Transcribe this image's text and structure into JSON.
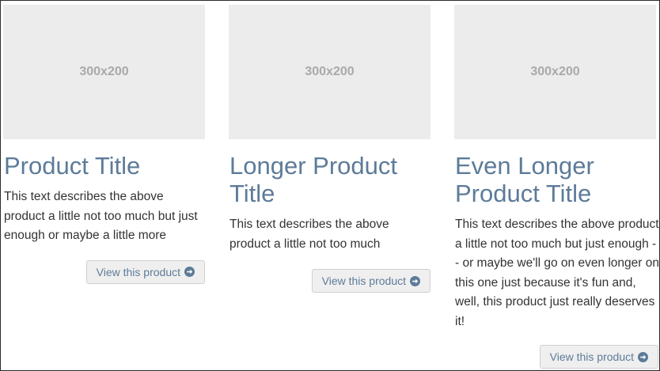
{
  "products": [
    {
      "image_label": "300x200",
      "title": "Product Title",
      "description": "This text describes the above product a little not too much but just enough or maybe a little more",
      "button_label": "View this product"
    },
    {
      "image_label": "300x200",
      "title": "Longer Product Title",
      "description": "This text describes the above product a little not too much",
      "button_label": "View this product"
    },
    {
      "image_label": "300x200",
      "title": "Even Longer Product Title",
      "description": "This text describes the above product a little not too much but just enough -- or maybe we'll go on even longer on this one just because it's fun and, well, this product just really deserves it!",
      "button_label": "View this product"
    }
  ],
  "icons": {
    "button_icon": "arrow-circle-right-icon"
  },
  "colors": {
    "title": "#5d7b99",
    "text": "#333333",
    "placeholder_bg": "#ececec",
    "placeholder_text": "#a9a9a9",
    "button_bg": "#efefef",
    "button_border": "#cfcfcf"
  }
}
